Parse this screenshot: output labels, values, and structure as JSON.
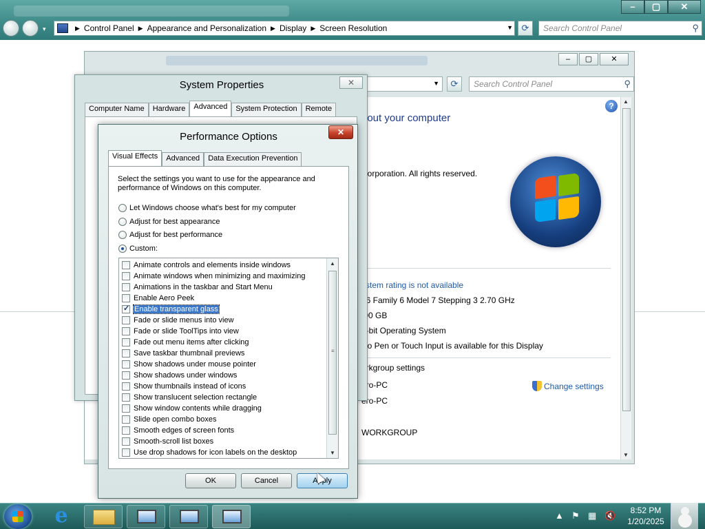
{
  "control_panel": {
    "breadcrumbs": [
      "Control Panel",
      "Appearance and Personalization",
      "Display",
      "Screen Resolution"
    ],
    "search_placeholder": "Search Control Panel",
    "window_buttons": {
      "minimize": "–",
      "maximize": "▢",
      "close": "✕"
    }
  },
  "system_window": {
    "search_placeholder": "Search Control Panel",
    "heading_fragment": "bout your computer",
    "copyright_fragment": "Corporation.  All rights reserved.",
    "rating_link": "ystem rating is not available",
    "processor": "86 Family 6 Model 7 Stepping 3   2.70 GHz",
    "memory": ".00 GB",
    "system_type": "2-bit Operating System",
    "pen_touch": "No Pen or Touch Input is available for this Display",
    "workgroup_heading": "orkgroup settings",
    "computer_name": "ero-PC",
    "full_name": "ero-PC",
    "workgroup": "WORKGROUP",
    "change_settings": "Change settings"
  },
  "system_properties": {
    "title": "System Properties",
    "close": "✕",
    "tabs": [
      "Computer Name",
      "Hardware",
      "Advanced",
      "System Protection",
      "Remote"
    ],
    "active_tab": "Advanced"
  },
  "performance_options": {
    "title": "Performance Options",
    "close": "✕",
    "tabs": [
      "Visual Effects",
      "Advanced",
      "Data Execution Prevention"
    ],
    "active_tab": "Visual Effects",
    "description": "Select the settings you want to use for the appearance and performance of Windows on this computer.",
    "radios": [
      {
        "label": "Let Windows choose what's best for my computer",
        "checked": false
      },
      {
        "label": "Adjust for best appearance",
        "checked": false
      },
      {
        "label": "Adjust for best performance",
        "checked": false
      },
      {
        "label": "Custom:",
        "checked": true
      }
    ],
    "effects": [
      {
        "label": "Animate controls and elements inside windows",
        "checked": false,
        "selected": false
      },
      {
        "label": "Animate windows when minimizing and maximizing",
        "checked": false,
        "selected": false
      },
      {
        "label": "Animations in the taskbar and Start Menu",
        "checked": false,
        "selected": false
      },
      {
        "label": "Enable Aero Peek",
        "checked": false,
        "selected": false
      },
      {
        "label": "Enable transparent glass",
        "checked": true,
        "selected": true
      },
      {
        "label": "Fade or slide menus into view",
        "checked": false,
        "selected": false
      },
      {
        "label": "Fade or slide ToolTips into view",
        "checked": false,
        "selected": false
      },
      {
        "label": "Fade out menu items after clicking",
        "checked": false,
        "selected": false
      },
      {
        "label": "Save taskbar thumbnail previews",
        "checked": false,
        "selected": false
      },
      {
        "label": "Show shadows under mouse pointer",
        "checked": false,
        "selected": false
      },
      {
        "label": "Show shadows under windows",
        "checked": false,
        "selected": false
      },
      {
        "label": "Show thumbnails instead of icons",
        "checked": false,
        "selected": false
      },
      {
        "label": "Show translucent selection rectangle",
        "checked": false,
        "selected": false
      },
      {
        "label": "Show window contents while dragging",
        "checked": false,
        "selected": false
      },
      {
        "label": "Slide open combo boxes",
        "checked": false,
        "selected": false
      },
      {
        "label": "Smooth edges of screen fonts",
        "checked": false,
        "selected": false
      },
      {
        "label": "Smooth-scroll list boxes",
        "checked": false,
        "selected": false
      },
      {
        "label": "Use drop shadows for icon labels on the desktop",
        "checked": false,
        "selected": false
      }
    ],
    "buttons": {
      "ok": "OK",
      "cancel": "Cancel",
      "apply": "Apply"
    }
  },
  "taskbar": {
    "time": "8:52 PM",
    "date": "1/20/2025"
  },
  "icons": [
    "back-icon",
    "forward-icon",
    "refresh-icon",
    "search-icon",
    "help-icon",
    "shield-icon",
    "windows-logo",
    "start-orb-icon",
    "internet-explorer-icon",
    "folder-icon",
    "flag-icon",
    "network-icon",
    "speaker-muted-icon",
    "user-icon"
  ]
}
